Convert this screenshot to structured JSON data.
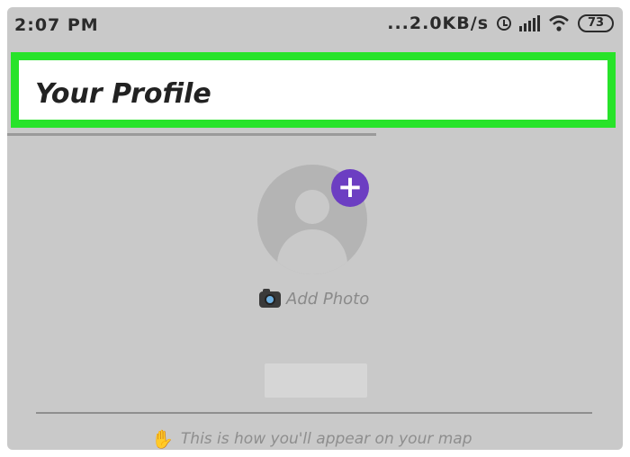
{
  "status_bar": {
    "time": "2:07 PM",
    "network_speed": "...2.0KB/s",
    "battery": "73"
  },
  "header": {
    "title": "Your Profile",
    "highlight_color": "#28e32a"
  },
  "profile": {
    "add_photo_label": "Add Photo",
    "plus_symbol": "+",
    "accent_color": "#6c3ec2"
  },
  "footer": {
    "hint_text": "This is how you'll appear on your map"
  },
  "icons": [
    "alarm-icon",
    "signal-icon",
    "wifi-icon",
    "battery-icon",
    "camera-icon",
    "waving-hand-icon",
    "plus-icon",
    "avatar-placeholder-icon"
  ]
}
